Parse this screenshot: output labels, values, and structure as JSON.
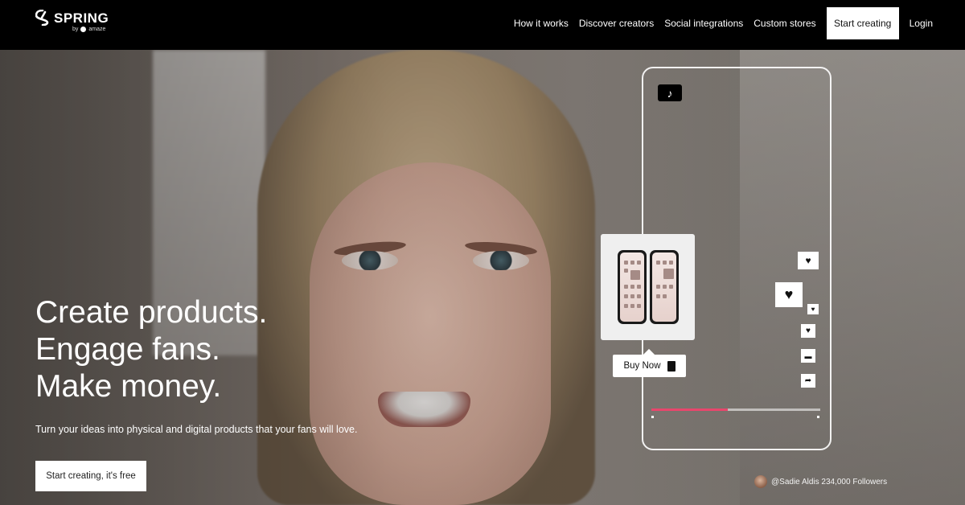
{
  "brand": {
    "name": "SPRING",
    "by_label": "by",
    "parent": "amaze"
  },
  "nav": {
    "links": [
      "How it works",
      "Discover creators",
      "Social integrations",
      "Custom stores"
    ],
    "cta_label": "Start creating",
    "login_label": "Login"
  },
  "hero": {
    "headline": [
      "Create products.",
      "Engage fans.",
      "Make money."
    ],
    "subline": "Turn your ideas into physical and digital products that your fans will love.",
    "cta_label": "Start creating, it's free"
  },
  "video": {
    "platform_icon": "tiktok-icon",
    "buy_now_label": "Buy Now",
    "creator_caption": "@Sadie Aldis 234,000 Followers",
    "progress": 0.45,
    "accent_color": "#e8466c"
  }
}
